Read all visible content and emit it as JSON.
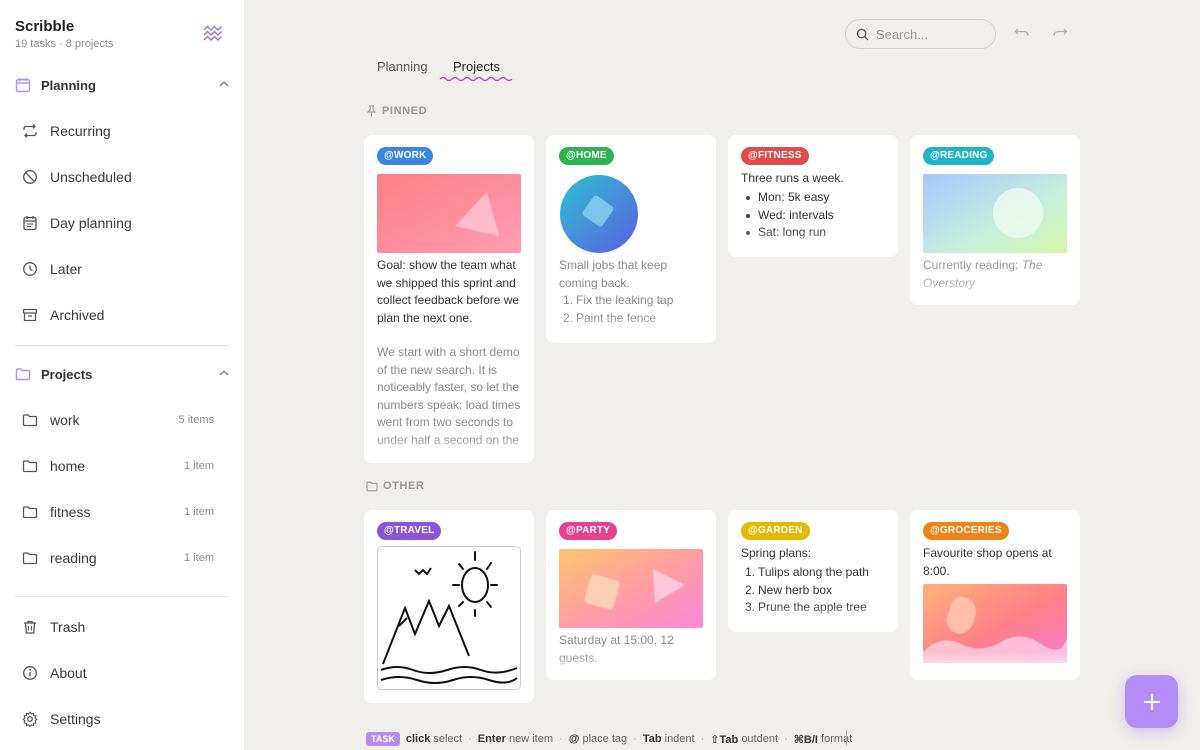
{
  "app": {
    "title": "Scribble",
    "subtitle": "19 tasks · 8 projects",
    "logo_icon": "zigzag-logo-icon"
  },
  "sidebar": {
    "planning": {
      "label": "Planning",
      "icon": "calendar-icon",
      "items": [
        {
          "label": "Recurring",
          "icon": "repeat-icon"
        },
        {
          "label": "Unscheduled",
          "icon": "slash-circle-icon"
        },
        {
          "label": "Day planning",
          "icon": "calendar-list-icon"
        },
        {
          "label": "Later",
          "icon": "clock-icon"
        },
        {
          "label": "Archived",
          "icon": "archive-icon"
        }
      ]
    },
    "projects": {
      "label": "Projects",
      "icon": "folder-icon",
      "items": [
        {
          "label": "work",
          "count": "5 items"
        },
        {
          "label": "home",
          "count": "1 item"
        },
        {
          "label": "fitness",
          "count": "1 item"
        },
        {
          "label": "reading",
          "count": "1 item"
        }
      ]
    },
    "footer": [
      {
        "label": "Trash",
        "icon": "trash-icon"
      },
      {
        "label": "About",
        "icon": "info-icon"
      },
      {
        "label": "Settings",
        "icon": "gear-icon"
      }
    ]
  },
  "toolbar": {
    "search_placeholder": "Search...",
    "undo_icon": "undo-icon",
    "redo_icon": "redo-icon"
  },
  "tabs": [
    {
      "label": "Planning",
      "active": false
    },
    {
      "label": "Projects",
      "active": true
    }
  ],
  "groups": {
    "pinned": "PINNED",
    "other": "OTHER"
  },
  "cards": {
    "work": {
      "tag": "@WORK",
      "color": "#3a86e0",
      "p1": "Goal: show the team what we shipped this sprint and collect feedback before we plan the next one.",
      "p2": "We start with a short demo of the new search. It is noticeably faster, so let the numbers speak: load times went from two seconds to under half a second on the"
    },
    "home": {
      "tag": "@HOME",
      "color": "#2fb352",
      "text": "Small jobs that keep coming back.",
      "items": [
        "Fix the leaking tap",
        "Paint the fence"
      ]
    },
    "fitness": {
      "tag": "@FITNESS",
      "color": "#e04b4b",
      "text": "Three runs a week.",
      "items": [
        "Mon: 5k easy",
        "Wed: intervals",
        "Sat: long run"
      ]
    },
    "reading": {
      "tag": "@READING",
      "color": "#1fb5c4",
      "text_prefix": "Currently reading: ",
      "text_title": "The Overstory"
    },
    "travel": {
      "tag": "@TRAVEL",
      "color": "#8a55d8"
    },
    "party": {
      "tag": "@PARTY",
      "color": "#e8408f",
      "text": "Saturday at 15:00, 12 guests."
    },
    "garden": {
      "tag": "@GARDEN",
      "color": "#e6b800",
      "text": "Spring plans:",
      "items": [
        "Tulips along the path",
        "New herb box",
        "Prune the apple tree"
      ]
    },
    "groceries": {
      "tag": "@GROCERIES",
      "color": "#ee8418",
      "text": "Favourite shop opens at 8:00."
    }
  },
  "hints": {
    "badge": "TASK",
    "items": [
      {
        "key": "click",
        "desc": "select"
      },
      {
        "key": "Enter",
        "desc": "new item"
      },
      {
        "key": "@",
        "desc": "place tag"
      },
      {
        "key": "Tab",
        "desc": "indent"
      },
      {
        "key": "⇧Tab",
        "desc": "outdent"
      },
      {
        "key": "⌘B/I",
        "desc": "format"
      }
    ]
  },
  "fab_icon": "plus-icon",
  "colors": {
    "accent": "#b58cf5",
    "background": "#f1efeb"
  }
}
